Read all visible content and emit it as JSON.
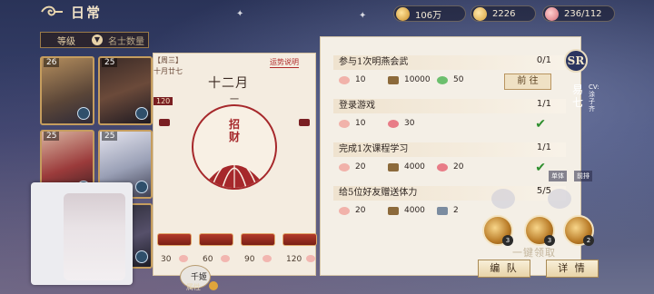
{
  "header": {
    "title": "日常"
  },
  "resources": [
    {
      "icon": "gold-coin-icon",
      "value": "106万"
    },
    {
      "icon": "feather-icon",
      "value": "2226"
    },
    {
      "icon": "flower-icon",
      "value": "236/112"
    }
  ],
  "sidebar": {
    "filter_label": "等级",
    "filter_label2": "名士数量",
    "cards": [
      {
        "level": "26"
      },
      {
        "level": "25"
      },
      {
        "level": "25"
      },
      {
        "level": "25"
      }
    ]
  },
  "calendar": {
    "weekday": "【周三】",
    "lunar": "十月廿七",
    "fortune_link": "运势说明",
    "month": "十二月",
    "day": "一",
    "seal_line1": "招",
    "seal_line2": "财",
    "tab_value": "120",
    "rewards": [
      "30",
      "60",
      "90",
      "120"
    ],
    "avatar_label": "千姬",
    "attr_label": "属性"
  },
  "tasks": [
    {
      "title": "参与1次明燕会武",
      "progress": "0/1",
      "rewards": [
        {
          "icon": "petal-icon",
          "value": "10"
        },
        {
          "icon": "book-icon",
          "value": "10000"
        },
        {
          "icon": "jade-icon",
          "value": "50"
        }
      ],
      "action": "前 往"
    },
    {
      "title": "登录游戏",
      "progress": "1/1",
      "rewards": [
        {
          "icon": "petal-icon",
          "value": "10"
        },
        {
          "icon": "flower-icon",
          "value": "30"
        }
      ]
    },
    {
      "title": "完成1次课程学习",
      "progress": "1/1",
      "rewards": [
        {
          "icon": "petal-icon",
          "value": "20"
        },
        {
          "icon": "book-icon",
          "value": "4000"
        },
        {
          "icon": "flower-icon",
          "value": "20"
        }
      ]
    },
    {
      "title": "给5位好友赠送体力",
      "progress": "5/5",
      "rewards": [
        {
          "icon": "petal-icon",
          "value": "20"
        },
        {
          "icon": "book-icon",
          "value": "4000"
        },
        {
          "icon": "scroll-icon",
          "value": "2"
        }
      ]
    }
  ],
  "character": {
    "rarity": "SR",
    "name": "易七",
    "cv": "CV:涂子齐",
    "mode_a": "单体",
    "mode_b": "前排"
  },
  "skills": [
    {
      "count": "3"
    },
    {
      "count": "3"
    },
    {
      "count": "2"
    }
  ],
  "footer": {
    "claim_all": "一键领取",
    "team_button": "编 队",
    "detail_button": "详 情"
  }
}
